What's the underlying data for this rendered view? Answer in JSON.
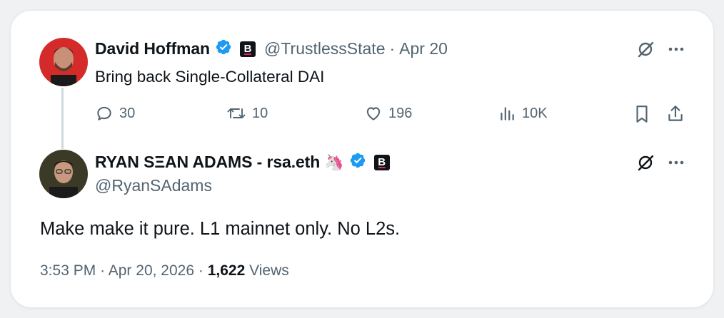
{
  "parent_tweet": {
    "author_name": "David Hoffman",
    "handle": "@TrustlessState",
    "separator": "·",
    "date": "Apr 20",
    "text": "Bring back Single-Collateral DAI",
    "badge_letter": "B",
    "actions": {
      "replies": "30",
      "reposts": "10",
      "likes": "196",
      "views": "10K"
    }
  },
  "main_tweet": {
    "author_name": "RYAN SΞAN ADAMS - rsa.eth",
    "emoji": "🦄",
    "handle": "@RyanSAdams",
    "badge_letter": "B",
    "text": "Make make it pure. L1 mainnet only. No L2s.",
    "time": "3:53 PM",
    "date": "Apr 20, 2026",
    "dot": "·",
    "views_count": "1,622",
    "views_label": "Views"
  },
  "colors": {
    "verified": "#1d9bf0",
    "muted": "#536471",
    "text": "#0f1419",
    "thread_line": "#cfd9de"
  }
}
